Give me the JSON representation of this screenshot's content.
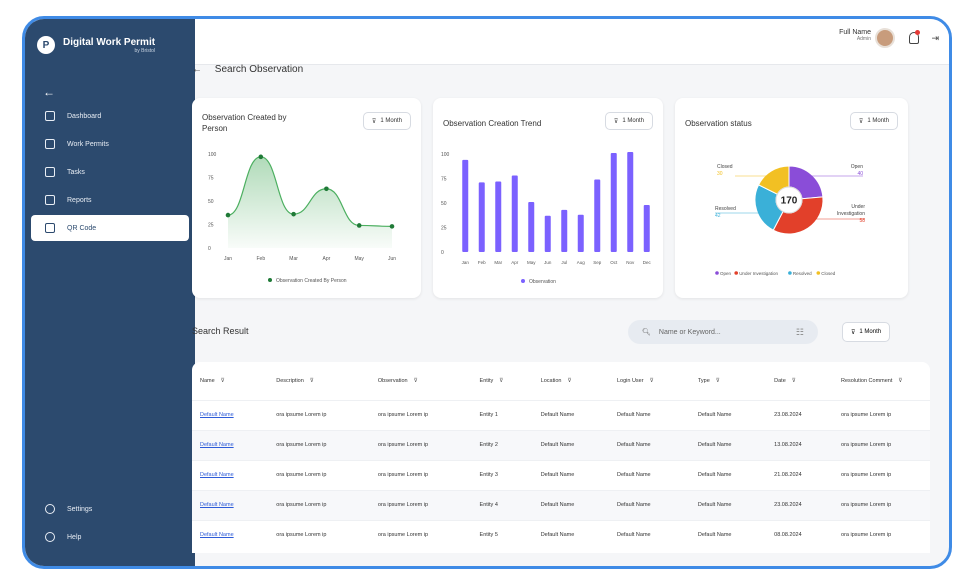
{
  "app": {
    "title": "Digital Work Permit",
    "subtitle": "by Bristol"
  },
  "sidebar": {
    "back": "←",
    "items": [
      {
        "label": "Dashboard",
        "icon": "dashboard-icon"
      },
      {
        "label": "Work Permits",
        "icon": "permit-icon"
      },
      {
        "label": "Tasks",
        "icon": "tasks-icon"
      },
      {
        "label": "Reports",
        "icon": "reports-icon"
      },
      {
        "label": "QR Code",
        "icon": "qr-code-icon",
        "active": true
      }
    ],
    "bottom": [
      {
        "label": "Settings",
        "icon": "settings-icon"
      },
      {
        "label": "Help",
        "icon": "help-icon"
      }
    ]
  },
  "header": {
    "user_name": "Full Name",
    "user_role": "Admin"
  },
  "page": {
    "back": "←",
    "title": "Search Observation"
  },
  "filter_label": "1 Month",
  "charts": {
    "person": {
      "title": "Observation Created by Person",
      "legend": "Observation Created By Person",
      "y_ticks": [
        "100",
        "75",
        "50",
        "25",
        "0"
      ],
      "chart_data": {
        "type": "area",
        "categories": [
          "Jan",
          "Feb",
          "Mar",
          "Apr",
          "May",
          "Jun"
        ],
        "values": [
          35,
          97,
          36,
          63,
          24,
          23
        ],
        "ylim": [
          0,
          100
        ]
      }
    },
    "trend": {
      "title": "Observation Creation Trend",
      "legend": "Observation",
      "y_ticks": [
        "100",
        "75",
        "50",
        "25",
        "0"
      ],
      "chart_data": {
        "type": "bar",
        "categories": [
          "Jan",
          "Feb",
          "Mar",
          "Apr",
          "May",
          "Jun",
          "Jul",
          "Aug",
          "Sep",
          "Oct",
          "Nov",
          "Dec"
        ],
        "values": [
          94,
          71,
          72,
          78,
          51,
          37,
          43,
          38,
          74,
          101,
          102,
          48
        ],
        "ylim": [
          0,
          100
        ]
      }
    },
    "status": {
      "title": "Observation status",
      "center": "170",
      "chart_data": {
        "type": "pie",
        "slices": [
          {
            "name": "Open",
            "value": 40,
            "color": "#8a4dd8"
          },
          {
            "name": "Under Investigation",
            "value": 58,
            "color": "#e2402a"
          },
          {
            "name": "Resolved",
            "value": 42,
            "color": "#3ab0d8"
          },
          {
            "name": "Closed",
            "value": 30,
            "color": "#f2c023"
          }
        ]
      },
      "labels": [
        {
          "name": "Closed",
          "value": "30"
        },
        {
          "name": "Open",
          "value": "40"
        },
        {
          "name": "Under Investigation",
          "value": "58"
        },
        {
          "name": "Resolved",
          "value": "42"
        }
      ],
      "legend": [
        "Open",
        "Under Investigation",
        "Resolved",
        "Closed"
      ]
    }
  },
  "search_result": {
    "title": "Search Result",
    "placeholder": "Name or Keyword...",
    "columns": [
      "Name",
      "Description",
      "Observation",
      "Entity",
      "Location",
      "Login User",
      "Type",
      "Date",
      "Resolution Comment"
    ],
    "rows": [
      [
        "Default Name",
        "ora ipsume Lorem ip",
        "ora ipsume Lorem ip",
        "Entity 1",
        "Default Name",
        "Default Name",
        "Default Name",
        "23.08.2024",
        "ora ipsume Lorem ip"
      ],
      [
        "Default Name",
        "ora ipsume Lorem ip",
        "ora ipsume Lorem ip",
        "Entity 2",
        "Default Name",
        "Default Name",
        "Default Name",
        "13.08.2024",
        "ora ipsume Lorem ip"
      ],
      [
        "Default Name",
        "ora ipsume Lorem ip",
        "ora ipsume Lorem ip",
        "Entity 3",
        "Default Name",
        "Default Name",
        "Default Name",
        "21.08.2024",
        "ora ipsume Lorem ip"
      ],
      [
        "Default Name",
        "ora ipsume Lorem ip",
        "ora ipsume Lorem ip",
        "Entity 4",
        "Default Name",
        "Default Name",
        "Default Name",
        "23.08.2024",
        "ora ipsume Lorem ip"
      ],
      [
        "Default Name",
        "ora ipsume Lorem ip",
        "ora ipsume Lorem ip",
        "Entity 5",
        "Default Name",
        "Default Name",
        "Default Name",
        "08.08.2024",
        "ora ipsume Lorem ip"
      ]
    ]
  }
}
